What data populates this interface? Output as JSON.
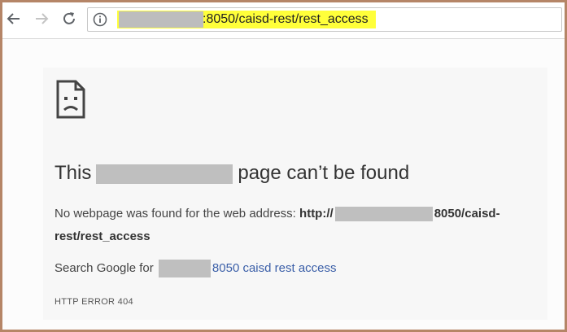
{
  "browser": {
    "back_icon": "arrow-left-icon",
    "forward_icon": "arrow-right-icon",
    "reload_icon": "reload-icon",
    "info_icon": "info-icon",
    "url_visible": ":8050/caisd-rest/rest_access",
    "highlight_color": "#ffff3a"
  },
  "error_page": {
    "icon": "sad-page-icon",
    "heading_start": "This",
    "heading_end": "page can’t be found",
    "desc_start": "No webpage was found for the web address:",
    "desc_url_start": "http://",
    "desc_url_end": "8050/caisd-rest/rest_access",
    "search_prefix": "Search Google for",
    "search_link": "8050 caisd rest access",
    "error_code": "HTTP ERROR 404",
    "link_color": "#3b5fa8"
  }
}
